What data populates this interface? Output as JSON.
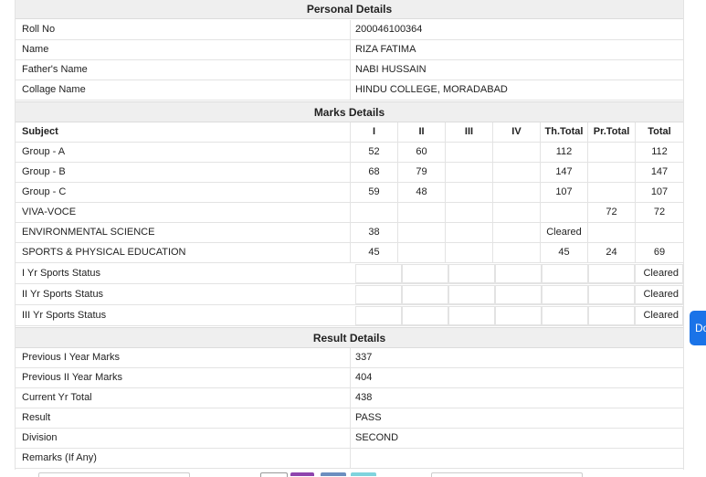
{
  "personal": {
    "title": "Personal Details",
    "rows": [
      {
        "label": "Roll No",
        "value": "200046100364"
      },
      {
        "label": "Name",
        "value": "RIZA FATIMA"
      },
      {
        "label": "Father's Name",
        "value": "NABI HUSSAIN"
      },
      {
        "label": "Collage Name",
        "value": "HINDU COLLEGE, MORADABAD"
      }
    ]
  },
  "marks": {
    "title": "Marks Details",
    "headers": [
      "Subject",
      "I",
      "II",
      "III",
      "IV",
      "Th.Total",
      "Pr.Total",
      "Total"
    ],
    "rows": [
      {
        "subject": "Group - A",
        "i": "52",
        "ii": "60",
        "iii": "",
        "iv": "",
        "th": "112",
        "pr": "",
        "total": "112"
      },
      {
        "subject": "Group - B",
        "i": "68",
        "ii": "79",
        "iii": "",
        "iv": "",
        "th": "147",
        "pr": "",
        "total": "147"
      },
      {
        "subject": "Group - C",
        "i": "59",
        "ii": "48",
        "iii": "",
        "iv": "",
        "th": "107",
        "pr": "",
        "total": "107"
      },
      {
        "subject": "VIVA-VOCE",
        "i": "",
        "ii": "",
        "iii": "",
        "iv": "",
        "th": "",
        "pr": "72",
        "total": "72"
      },
      {
        "subject": "ENVIRONMENTAL SCIENCE",
        "i": "38",
        "ii": "",
        "iii": "",
        "iv": "",
        "th": "Cleared",
        "pr": "",
        "total": ""
      },
      {
        "subject": "SPORTS & PHYSICAL EDUCATION",
        "i": "45",
        "ii": "",
        "iii": "",
        "iv": "",
        "th": "45",
        "pr": "24",
        "total": "69"
      }
    ],
    "sports_status": [
      {
        "label": "I Yr Sports Status",
        "status": "Cleared"
      },
      {
        "label": "II Yr Sports Status",
        "status": "Cleared"
      },
      {
        "label": "III Yr Sports Status",
        "status": "Cleared"
      }
    ]
  },
  "result": {
    "title": "Result Details",
    "rows": [
      {
        "label": "Previous I Year Marks",
        "value": "337"
      },
      {
        "label": "Previous II Year Marks",
        "value": "404"
      },
      {
        "label": "Current Yr Total",
        "value": "438"
      },
      {
        "label": "Result",
        "value": "PASS"
      },
      {
        "label": "Division",
        "value": "SECOND"
      },
      {
        "label": "Remarks (If Any)",
        "value": ""
      }
    ]
  },
  "side_button": {
    "label": "Do"
  },
  "colors": {
    "accent": "#1a73e8",
    "header_bg": "#efefef",
    "border": "#e3e3e3"
  }
}
